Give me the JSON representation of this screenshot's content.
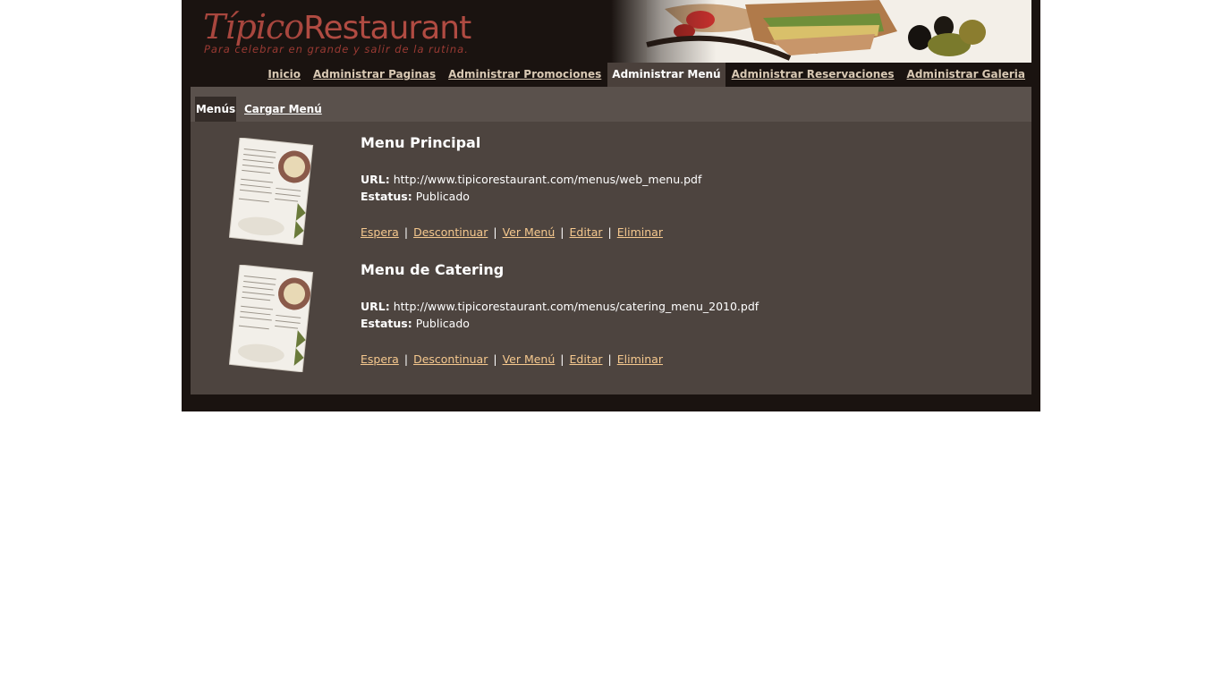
{
  "header": {
    "logo_part1": "Típico",
    "logo_part2": "Restaurant",
    "tagline": "Para celebrar en grande y salir de la rutina."
  },
  "nav": {
    "items": [
      {
        "label": "Inicio",
        "active": false
      },
      {
        "label": "Administrar Paginas",
        "active": false
      },
      {
        "label": "Administrar Promociones",
        "active": false
      },
      {
        "label": "Administrar Menú",
        "active": true
      },
      {
        "label": "Administrar Reservaciones",
        "active": false
      },
      {
        "label": "Administrar Galeria",
        "active": false
      }
    ]
  },
  "subnav": {
    "active_tab": "Menús",
    "link_tab": "Cargar Menú"
  },
  "menus": [
    {
      "title": "Menu Principal",
      "url_label": "URL:",
      "url": "http://www.tipicorestaurant.com/menus/web_menu.pdf",
      "status_label": "Estatus:",
      "status": "Publicado",
      "actions": [
        "Espera",
        "Descontinuar",
        "Ver Menú",
        "Editar",
        "Eliminar"
      ]
    },
    {
      "title": "Menu de Catering",
      "url_label": "URL:",
      "url": "http://www.tipicorestaurant.com/menus/catering_menu_2010.pdf",
      "status_label": "Estatus:",
      "status": "Publicado",
      "actions": [
        "Espera",
        "Descontinuar",
        "Ver Menú",
        "Editar",
        "Eliminar"
      ]
    }
  ],
  "colors": {
    "page_bg": "#1a1310",
    "panel_bg": "#4d443f",
    "link_color": "#f5c88e",
    "brand_red": "#a8463e"
  }
}
